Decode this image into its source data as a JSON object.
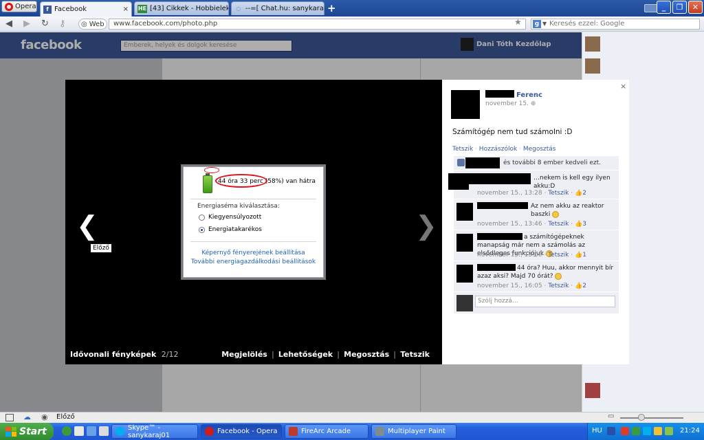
{
  "browser": {
    "menu_label": "Opera",
    "tabs": [
      {
        "label": "Facebook",
        "active": true
      },
      {
        "label": "[43] Cikkek - Hobbielektr…",
        "badge": "HE"
      },
      {
        "label": "--=[ Chat.hu: sanykaraj …"
      }
    ],
    "new_tab": "+",
    "address_mode": "Web",
    "url": "www.facebook.com/photo.php",
    "search_placeholder": "Keresés ezzel: Google"
  },
  "facebook": {
    "logo": "facebook",
    "search_placeholder": "Emberek, helyek és dolgok keresése",
    "user": "Dani Tóth",
    "home": "Kezdőlap"
  },
  "viewer": {
    "prev_tooltip": "Előző",
    "album": "Idővonali fényképek",
    "count": "2/12",
    "actions": [
      "Megjelölés",
      "Lehetőségek",
      "Megosztás",
      "Tetszik"
    ],
    "photo": {
      "battery_text": "44 óra 33 perc (58%) van hátra",
      "scheme_label": "Energiaséma kiválasztása:",
      "options": [
        {
          "label": "Kiegyensúlyozott",
          "selected": false
        },
        {
          "label": "Energiatakarékos",
          "selected": true
        }
      ],
      "links": [
        "Képernyő fényerejének beállítása",
        "További energiagazdálkodási beállítások"
      ]
    }
  },
  "panel": {
    "close": "×",
    "author": "Ferenc",
    "date": "november 15.",
    "status": "Számítógép nem tud számolni :D",
    "actions": [
      "Tetszik",
      "Hozzászólok",
      "Megosztás"
    ],
    "likes_text": "és további 8 ember kedveli ezt.",
    "comments": [
      {
        "text": "…nekem is kell egy ilyen akku:D",
        "meta": "november 15., 13:28",
        "like": "Tetszik",
        "count": "2"
      },
      {
        "text": "Az nem akku az reaktor baszki",
        "meta": "november 15., 13:46",
        "like": "Tetszik",
        "count": "3"
      },
      {
        "text": "a számítógépeknek manapság már nem a számolás az elsődleges funkciójuk",
        "meta": "november 15., 15:00",
        "like": "Tetszik",
        "count": "1"
      },
      {
        "text": "44 óra? Huu, akkor mennyit bír azaz aksi? Majd 70 órát?",
        "meta": "november 15., 16:05",
        "like": "Tetszik",
        "count": "2"
      }
    ],
    "write_placeholder": "Szólj hozzá..."
  },
  "statusbar": {
    "text": "Előző"
  },
  "taskbar": {
    "start": "Start",
    "buttons": [
      {
        "label": "Skype™ - sanykaraj01",
        "color": "#00aff0"
      },
      {
        "label": "Facebook - Opera",
        "color": "#d11a1a",
        "active": true
      },
      {
        "label": "FireArc Arcade",
        "color": "#c0392b"
      },
      {
        "label": "Multiplayer Paint",
        "color": "#7f8c8d"
      }
    ],
    "lang": "HU",
    "clock": "21:24"
  },
  "colors": {
    "fb_blue": "#3b5998",
    "taskbar_blue": "#245edb",
    "start_green": "#3c9a3a"
  }
}
